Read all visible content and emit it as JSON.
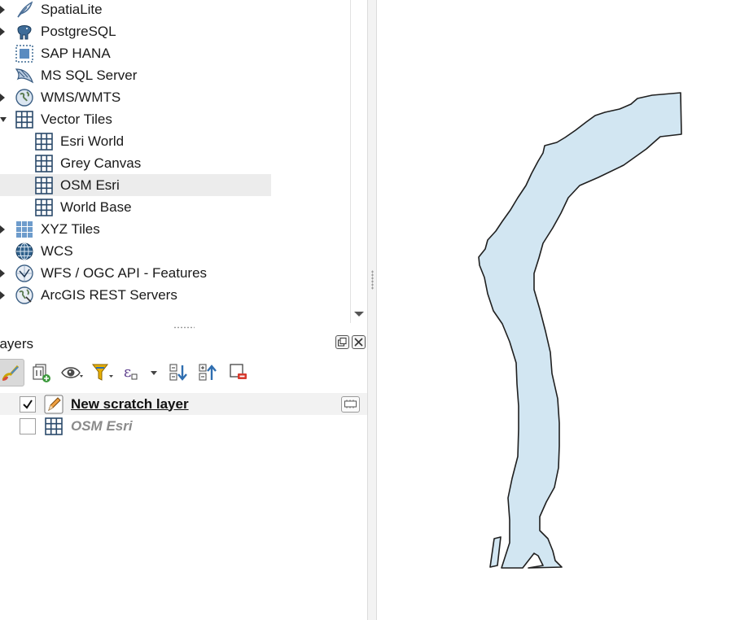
{
  "browser": {
    "items": [
      {
        "label": "SpatiaLite",
        "icon": "feather-icon",
        "expandable": true,
        "expanded": false
      },
      {
        "label": "PostgreSQL",
        "icon": "elephant-icon",
        "expandable": true,
        "expanded": false
      },
      {
        "label": "SAP HANA",
        "icon": "sap-hana-icon",
        "expandable": false,
        "expanded": false
      },
      {
        "label": "MS SQL Server",
        "icon": "mssql-icon",
        "expandable": false,
        "expanded": false
      },
      {
        "label": "WMS/WMTS",
        "icon": "globe-icon",
        "expandable": true,
        "expanded": false
      },
      {
        "label": "Vector Tiles",
        "icon": "vector-tiles-icon",
        "expandable": true,
        "expanded": true
      },
      {
        "label": "Esri World",
        "icon": "vector-tiles-icon",
        "child": true
      },
      {
        "label": "Grey Canvas",
        "icon": "vector-tiles-icon",
        "child": true
      },
      {
        "label": "OSM Esri",
        "icon": "vector-tiles-icon",
        "child": true,
        "selected": true
      },
      {
        "label": "World Base",
        "icon": "vector-tiles-icon",
        "child": true
      },
      {
        "label": "XYZ Tiles",
        "icon": "xyz-tiles-icon",
        "expandable": true,
        "expanded": false
      },
      {
        "label": "WCS",
        "icon": "wcs-globe-icon",
        "expandable": false
      },
      {
        "label": "WFS / OGC API - Features",
        "icon": "wfs-globe-icon",
        "expandable": true,
        "expanded": false
      },
      {
        "label": "ArcGIS REST Servers",
        "icon": "arcgis-globe-icon",
        "expandable": true,
        "expanded": false
      }
    ]
  },
  "layers_panel": {
    "title": "Layers",
    "toolbar": [
      "style-brush-icon",
      "add-group-icon",
      "eye-icon",
      "filter-icon",
      "expression-filter-icon",
      "expand-all-icon",
      "collapse-all-icon",
      "remove-layer-icon"
    ],
    "layers": [
      {
        "name": "New scratch layer",
        "checked": true,
        "icon": "pencil-icon",
        "current": true
      },
      {
        "name": "OSM Esri",
        "checked": false,
        "icon": "vector-tiles-icon",
        "current": false
      }
    ]
  },
  "colors": {
    "lake_fill": "#d2e6f2",
    "lake_stroke": "#1f1f1f",
    "selection": "#ececec",
    "icon_blue": "#2e5f8a"
  }
}
